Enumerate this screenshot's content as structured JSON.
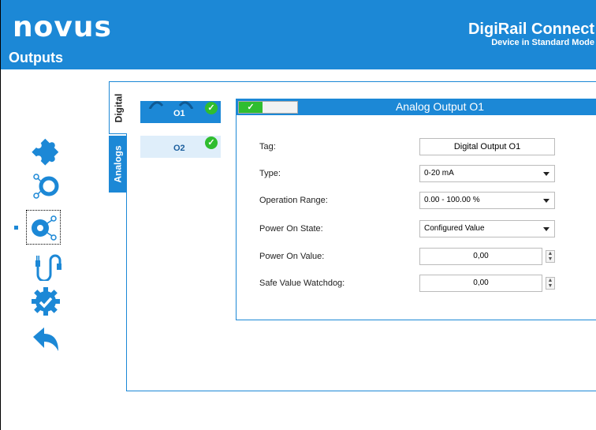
{
  "header": {
    "logo": "novus",
    "screen_title": "Outputs",
    "app_name": "DigiRail Connect",
    "app_mode": "Device in Standard Mode",
    "bg_color": "#1c88d6"
  },
  "sidebar": {
    "items": [
      {
        "name": "puzzle-icon"
      },
      {
        "name": "inputs-icon"
      },
      {
        "name": "outputs-icon",
        "selected": true
      },
      {
        "name": "connection-icon"
      },
      {
        "name": "settings-check-icon"
      },
      {
        "name": "back-arrow-icon"
      }
    ]
  },
  "tabs": {
    "digital": "Digital",
    "analogs": "Analogs"
  },
  "outputs": [
    {
      "label": "O1",
      "status": "✓"
    },
    {
      "label": "O2",
      "status": "✓"
    }
  ],
  "form": {
    "title": "Analog Output O1",
    "enabled_mark": "✓",
    "tag_label": "Tag:",
    "tag_value": "Digital Output O1",
    "type_label": "Type:",
    "type_value": "0-20 mA",
    "range_label": "Operation Range:",
    "range_value": "0.00 - 100.00 %",
    "power_on_state_label": "Power On State:",
    "power_on_state_value": "Configured Value",
    "power_on_value_label": "Power On Value:",
    "power_on_value": "0,00",
    "safe_value_label": "Safe Value Watchdog:",
    "safe_value": "0,00"
  },
  "colors": {
    "accent": "#1c88d6",
    "success": "#2fbd2f"
  }
}
